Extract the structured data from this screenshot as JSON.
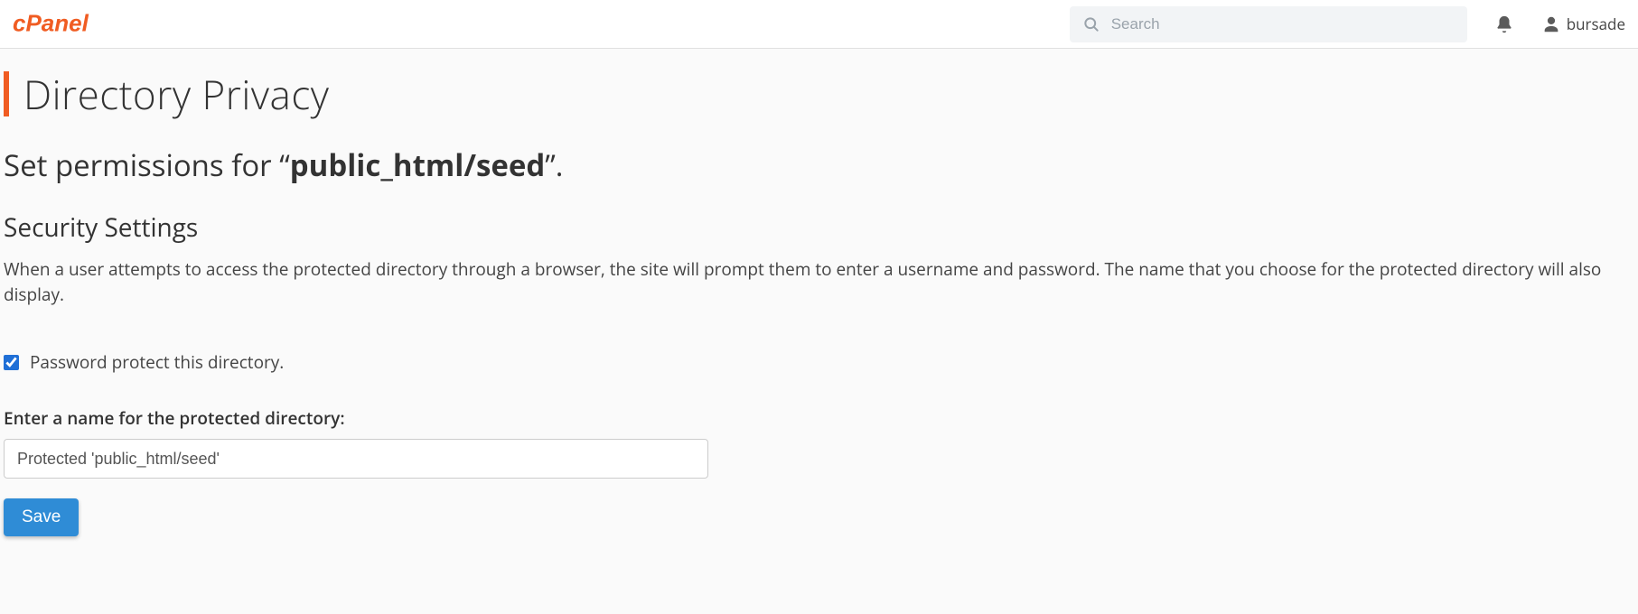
{
  "brand": {
    "name": "cPanel"
  },
  "search": {
    "placeholder": "Search"
  },
  "user": {
    "name": "bursade"
  },
  "page": {
    "title": "Directory Privacy"
  },
  "permissions": {
    "prefix": "Set permissions for “",
    "path": "public_html/seed",
    "suffix": "”."
  },
  "security": {
    "heading": "Security Settings",
    "description": "When a user attempts to access the protected directory through a browser, the site will prompt them to enter a username and password. The name that you choose for the protected directory will also display.",
    "checkbox_label": "Password protect this directory.",
    "checkbox_checked": true,
    "name_field_label": "Enter a name for the protected directory:",
    "name_field_value": "Protected 'public_html/seed'",
    "save_label": "Save"
  }
}
